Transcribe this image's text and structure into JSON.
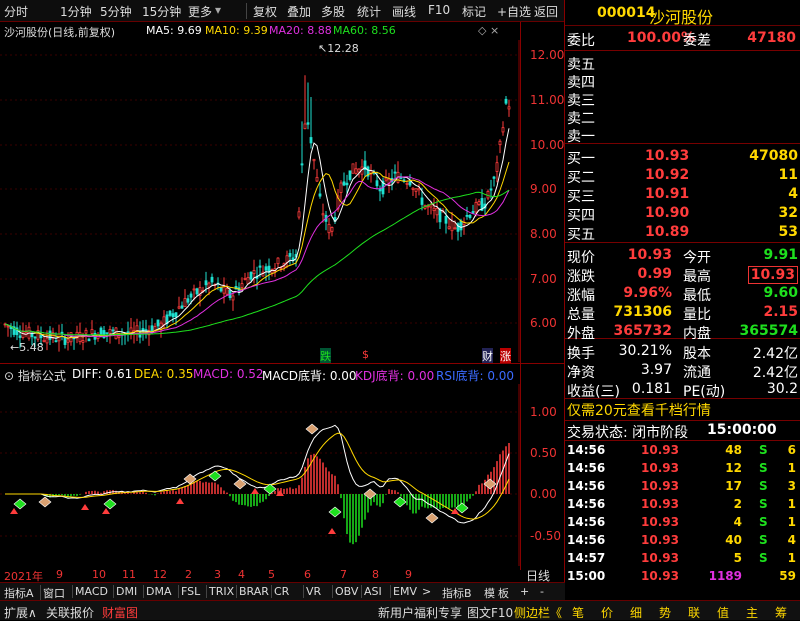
{
  "toolbar": {
    "periods": [
      "分时",
      "1分钟",
      "5分钟",
      "15分钟",
      "更多"
    ],
    "actions": [
      "复权",
      "叠加",
      "多股",
      "统计",
      "画线",
      "F10",
      "标记",
      "+自选",
      "返回"
    ]
  },
  "chart_header": {
    "name": "沙河股份(日线,前复权)",
    "ma5": "MA5: 9.69",
    "ma10": "MA10: 9.39",
    "ma20": "MA20: 8.88",
    "ma60": "MA60: 8.56",
    "high_mark": "12.28",
    "low_mark": "5.48"
  },
  "price_axis": [
    "12.00",
    "11.00",
    "10.00",
    "9.00",
    "8.00",
    "7.00",
    "6.00"
  ],
  "markers": {
    "die": "跌",
    "s": "$",
    "cai": "财",
    "zhang": "涨"
  },
  "indicator": {
    "name": "指标公式",
    "diff": "DIFF: 0.61",
    "dea": "DEA: 0.35",
    "macd": "MACD: 0.52",
    "macd_bottom": "MACD底背: 0.00",
    "kdj_bottom": "KDJ底背: 0.00",
    "rsi_bottom": "RSI底背: 0.00"
  },
  "ind_axis": [
    "1.00",
    "0.50",
    "0.00",
    "-0.50"
  ],
  "time_axis": [
    "2021年",
    "9",
    "10",
    "11",
    "12",
    "2",
    "3",
    "4",
    "5",
    "6",
    "7",
    "8",
    "9"
  ],
  "period_label": "日线",
  "tabs": [
    "指标A",
    "窗口",
    "MACD",
    "DMI",
    "DMA",
    "FSL",
    "TRIX",
    "BRAR",
    "CR",
    "VR",
    "OBV",
    "ASI",
    "EMV",
    ">",
    "指标B",
    "模",
    "板",
    "+",
    "-"
  ],
  "bottom": {
    "left": [
      "扩展∧",
      "关联报价",
      "财富图"
    ],
    "right": [
      "新用户福利专享",
      "图文F10",
      "侧边栏《"
    ],
    "nav": [
      "笔",
      "价",
      "细",
      "势",
      "联",
      "值",
      "主",
      "筹"
    ]
  },
  "stock": {
    "code": "000014",
    "name": "沙河股份"
  },
  "weibi": {
    "label": "委比",
    "value": "100.00%",
    "label2": "委差",
    "value2": "47180"
  },
  "asks": [
    {
      "label": "卖五"
    },
    {
      "label": "卖四"
    },
    {
      "label": "卖三"
    },
    {
      "label": "卖二"
    },
    {
      "label": "卖一"
    }
  ],
  "bids": [
    {
      "label": "买一",
      "price": "10.93",
      "vol": "47080"
    },
    {
      "label": "买二",
      "price": "10.92",
      "vol": "11"
    },
    {
      "label": "买三",
      "price": "10.91",
      "vol": "4"
    },
    {
      "label": "买四",
      "price": "10.90",
      "vol": "32"
    },
    {
      "label": "买五",
      "price": "10.89",
      "vol": "53"
    }
  ],
  "quote": [
    {
      "l1": "现价",
      "v1": "10.93",
      "l2": "今开",
      "v2": "9.91"
    },
    {
      "l1": "涨跌",
      "v1": "0.99",
      "l2": "最高",
      "v2": "10.93"
    },
    {
      "l1": "涨幅",
      "v1": "9.96%",
      "l2": "最低",
      "v2": "9.60"
    },
    {
      "l1": "总量",
      "v1": "731306",
      "l2": "量比",
      "v2": "2.15"
    },
    {
      "l1": "外盘",
      "v1": "365732",
      "l2": "内盘",
      "v2": "365574"
    }
  ],
  "stats": [
    {
      "l1": "换手",
      "v1": "30.21%",
      "l2": "股本",
      "v2": "2.42亿"
    },
    {
      "l1": "净资",
      "v1": "3.97",
      "l2": "流通",
      "v2": "2.42亿"
    },
    {
      "l1": "收益(三)",
      "v1": "0.181",
      "l2": "PE(动)",
      "v2": "30.2"
    }
  ],
  "promo": "仅需20元查看千档行情",
  "trade_status": {
    "label": "交易状态: 闭市阶段",
    "time": "15:00:00"
  },
  "ticks": [
    {
      "time": "14:56",
      "price": "10.93",
      "vol": "48",
      "bs": "S",
      "n": "6"
    },
    {
      "time": "14:56",
      "price": "10.93",
      "vol": "12",
      "bs": "S",
      "n": "1"
    },
    {
      "time": "14:56",
      "price": "10.93",
      "vol": "17",
      "bs": "S",
      "n": "3"
    },
    {
      "time": "14:56",
      "price": "10.93",
      "vol": "2",
      "bs": "S",
      "n": "1"
    },
    {
      "time": "14:56",
      "price": "10.93",
      "vol": "4",
      "bs": "S",
      "n": "1"
    },
    {
      "time": "14:56",
      "price": "10.93",
      "vol": "40",
      "bs": "S",
      "n": "4"
    },
    {
      "time": "14:57",
      "price": "10.93",
      "vol": "5",
      "bs": "S",
      "n": "1"
    },
    {
      "time": "15:00",
      "price": "10.93",
      "vol": "1189",
      "bs": "",
      "n": "59"
    }
  ],
  "colors": {
    "up": "#ff3c3c",
    "down": "#1ee01e",
    "ma5": "#ffffff",
    "ma10": "#ffd800",
    "ma20": "#e030e0",
    "ma60": "#1ee01e"
  }
}
